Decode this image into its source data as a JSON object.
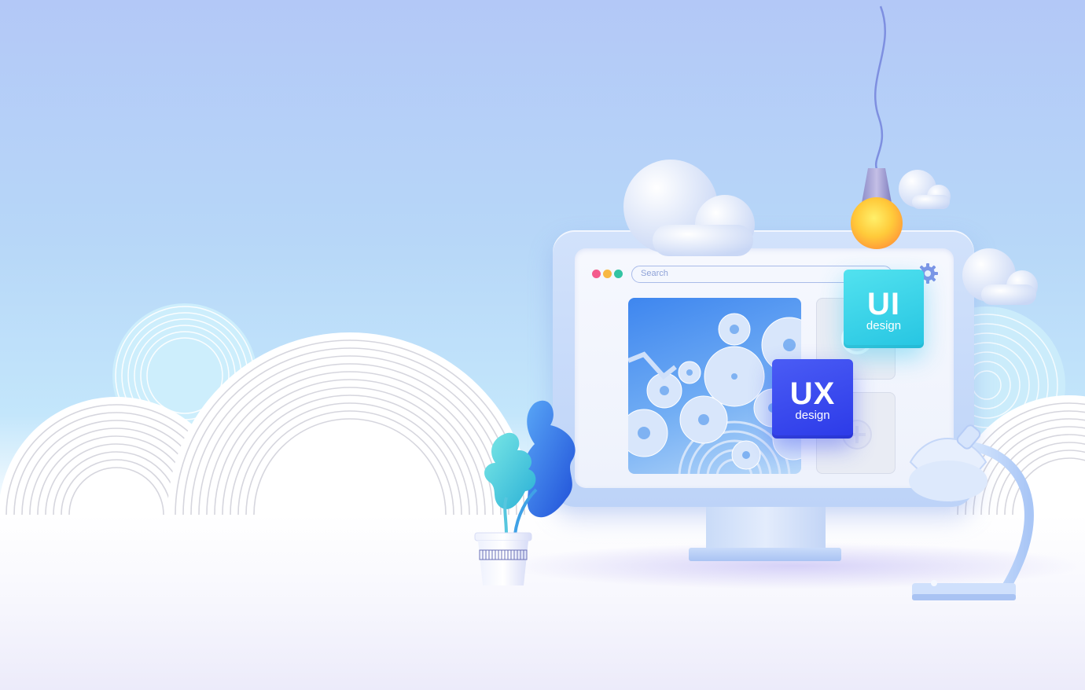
{
  "screen": {
    "search_placeholder": "Search"
  },
  "badges": {
    "ui": {
      "title": "UI",
      "subtitle": "design"
    },
    "ux": {
      "title": "UX",
      "subtitle": "design"
    }
  },
  "window_dots": [
    "#f45a8c",
    "#f8b843",
    "#33c4a3"
  ],
  "icons": [
    "gear-icon",
    "plus-icon",
    "light-bulb-icon",
    "desk-lamp-icon",
    "plant-icon",
    "cloud-icon"
  ],
  "colors": {
    "accent_cyan": "#2ec9e4",
    "accent_blue": "#3a48ef",
    "panel_blue": "#3e86ef"
  }
}
